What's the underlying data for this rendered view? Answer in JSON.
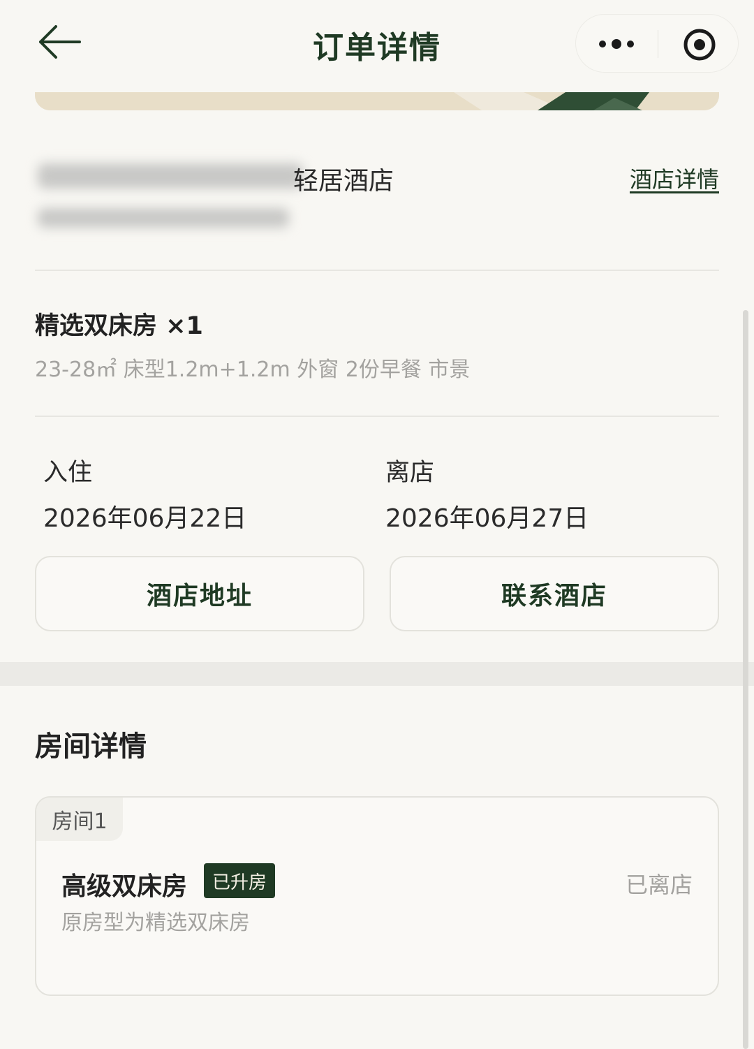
{
  "nav": {
    "title": "订单详情",
    "back_icon": "arrow-left-icon",
    "more_icon": "more-dots-icon",
    "close_icon": "target-circle-icon"
  },
  "hotel": {
    "name_visible": "轻居酒店",
    "detail_link": "酒店详情"
  },
  "room": {
    "title": "精选双床房 ×1",
    "specs": "23-28㎡ 床型1.2m+1.2m 外窗 2份早餐 市景"
  },
  "stay": {
    "checkin_label": "入住",
    "checkin_date": "2026年06月22日",
    "checkout_label": "离店",
    "checkout_date": "2026年06月27日"
  },
  "actions": {
    "address": "酒店地址",
    "contact": "联系酒店"
  },
  "room_details": {
    "section_title": "房间详情",
    "rooms": [
      {
        "tab": "房间1",
        "type": "高级双床房",
        "badge": "已升房",
        "status": "已离店",
        "original": "原房型为精选双床房"
      }
    ]
  },
  "colors": {
    "accent": "#1f3a24",
    "background": "#f8f7f3",
    "muted_text": "#a3a29f"
  }
}
